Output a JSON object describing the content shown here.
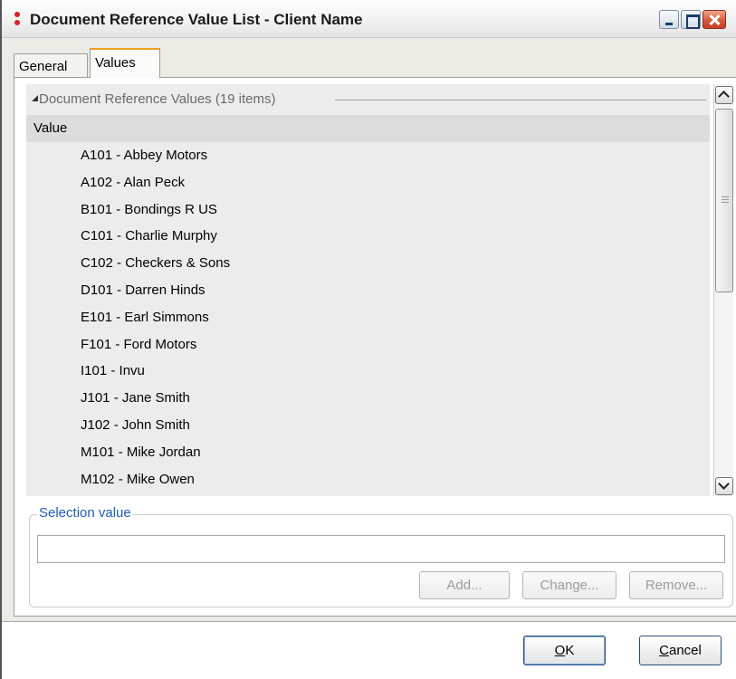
{
  "window": {
    "title": "Document Reference Value List - Client Name"
  },
  "tabs": [
    {
      "label": "General",
      "active": false
    },
    {
      "label": "Values",
      "active": true
    }
  ],
  "values_list": {
    "group_header": "Document Reference Values (19 items)",
    "column_header": "Value",
    "items": [
      "A101 - Abbey Motors",
      "A102 - Alan Peck",
      "B101 - Bondings R US",
      "C101 - Charlie Murphy",
      "C102 - Checkers & Sons",
      "D101 - Darren Hinds",
      "E101 - Earl Simmons",
      "F101 - Ford Motors",
      "I101 - Invu",
      "J101 - Jane Smith",
      "J102 - John Smith",
      "M101 - Mike Jordan",
      "M102 - Mike Owen"
    ]
  },
  "selection": {
    "legend": "Selection value",
    "value": "",
    "add_label": "Add...",
    "change_label": "Change...",
    "remove_label": "Remove..."
  },
  "footer": {
    "ok_accel": "O",
    "ok_rest": "K",
    "cancel_accel": "C",
    "cancel_rest": "ancel"
  },
  "colors": {
    "active_tab_accent": "#f0a11e",
    "legend_text": "#1e5dc5",
    "close_button": "#d45a3a",
    "app_icon": "#d91f2a"
  },
  "icons": {
    "app": "app-dots-icon",
    "minimize": "minimize-icon",
    "maximize": "maximize-icon",
    "close": "close-icon",
    "collapse": "collapse-triangle-icon",
    "scroll_up": "chevron-up-icon",
    "scroll_down": "chevron-down-icon"
  }
}
